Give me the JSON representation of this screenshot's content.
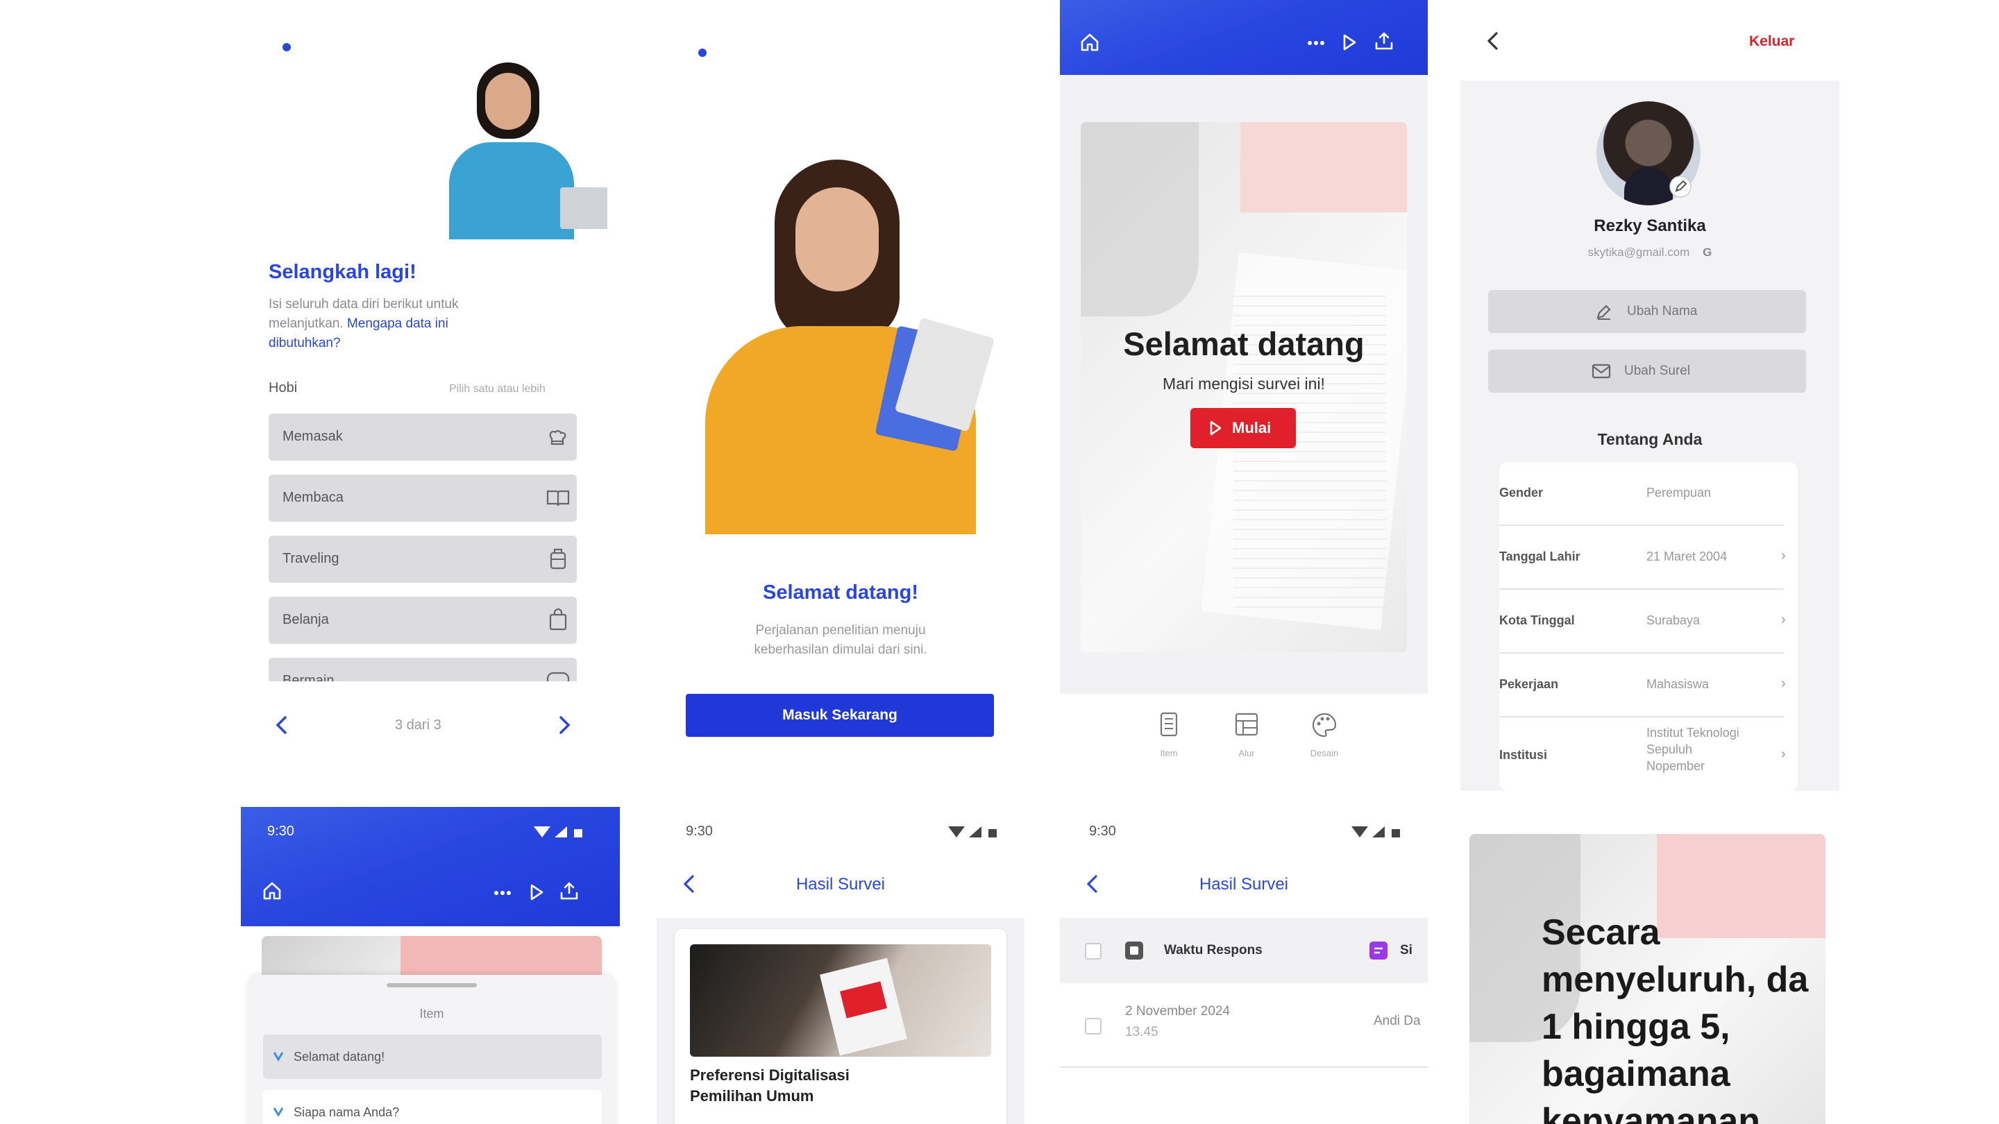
{
  "screen1": {
    "title": "Selangkah lagi!",
    "desc_line1": "Isi seluruh data diri berikut untuk",
    "desc_line2": "melanjutkan.",
    "link_line1": "Mengapa data ini",
    "link_line2": "dibutuhkan?",
    "field_label": "Hobi",
    "field_hint": "Pilih satu atau lebih",
    "options": [
      "Memasak",
      "Membaca",
      "Traveling",
      "Belanja",
      "Bermain"
    ],
    "pagination": "3 dari 3"
  },
  "screen2": {
    "title": "Selamat datang!",
    "desc_line1": "Perjalanan penelitian menuju",
    "desc_line2": "keberhasilan dimulai dari sini.",
    "button": "Masuk Sekarang"
  },
  "screen3": {
    "hero_title": "Selamat datang",
    "hero_subtitle": "Mari mengisi survei ini!",
    "start_button": "Mulai",
    "tabs": [
      "Item",
      "Alur",
      "Desain"
    ]
  },
  "screen4": {
    "logout": "Keluar",
    "name": "Rezky Santika",
    "email": "skytika@gmail.com",
    "edit_name": "Ubah Nama",
    "edit_email": "Ubah Surel",
    "section_title": "Tentang Anda",
    "rows": [
      {
        "label": "Gender",
        "value": "Perempuan"
      },
      {
        "label": "Tanggal Lahir",
        "value": "21 Maret 2004"
      },
      {
        "label": "Kota Tinggal",
        "value": "Surabaya"
      },
      {
        "label": "Pekerjaan",
        "value": "Mahasiswa"
      },
      {
        "label": "Institusi",
        "value_line1": "Institut Teknologi",
        "value_line2": "Sepuluh",
        "value_line3": "Nopember"
      }
    ]
  },
  "screen5": {
    "time": "9:30",
    "sheet_title": "Item",
    "items": [
      "Selamat datang!",
      "Siapa nama Anda?"
    ]
  },
  "screen6": {
    "time": "9:30",
    "title": "Hasil Survei",
    "card_title_line1": "Preferensi Digitalisasi",
    "card_title_line2": "Pemilihan Umum"
  },
  "screen7": {
    "time": "9:30",
    "title": "Hasil Survei",
    "col1": "Waktu Respons",
    "col2": "Si",
    "row_date": "2 November 2024",
    "row_time": "13.45",
    "row_name": "Andi Da"
  },
  "screen8": {
    "question_line1": "Secara",
    "question_line2": "menyeluruh, da",
    "question_line3": "1 hingga 5,",
    "question_line4": "bagaimana",
    "question_line5": "kenyamanan"
  },
  "colors": {
    "primary": "#2a46e0",
    "accent_red": "#e0202a",
    "link": "#2a46e0"
  }
}
